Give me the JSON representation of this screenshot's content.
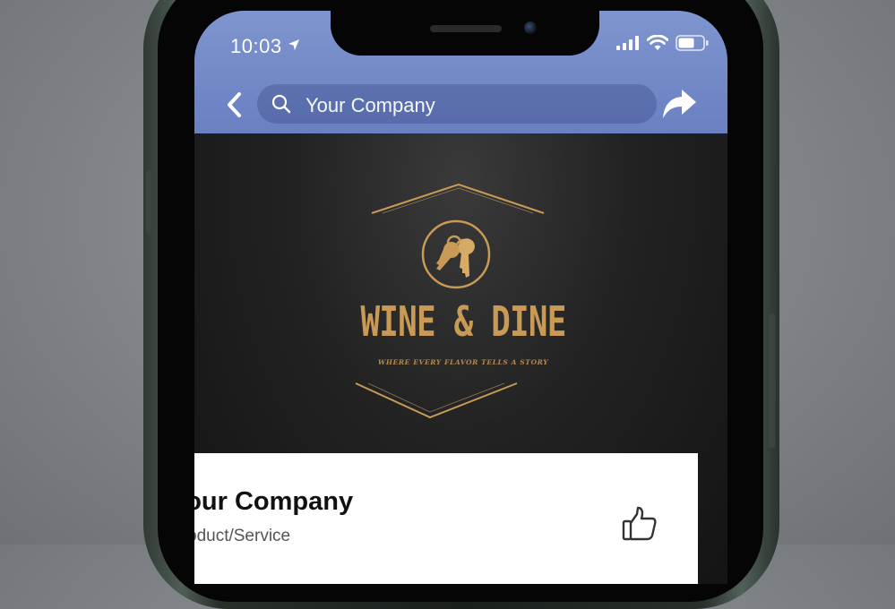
{
  "status_bar": {
    "time": "10:03",
    "location_icon": "location-arrow-icon",
    "signal_icon": "cellular-signal-icon",
    "wifi_icon": "wifi-icon",
    "battery_icon": "battery-icon"
  },
  "header": {
    "search_text": "Your Company",
    "back_icon": "chevron-left-icon",
    "search_icon": "search-icon",
    "share_icon": "share-icon",
    "color": "#6f86c7"
  },
  "cover": {
    "logo_title": "WINE & DINE",
    "logo_tagline": "WHERE EVERY FLAVOR TELLS A STORY",
    "logo_icon": "keys-icon",
    "gold_color": "#c89a55"
  },
  "profile": {
    "name": "Your Company",
    "category": "Product/Service",
    "like_icon": "thumbs-up-icon"
  }
}
